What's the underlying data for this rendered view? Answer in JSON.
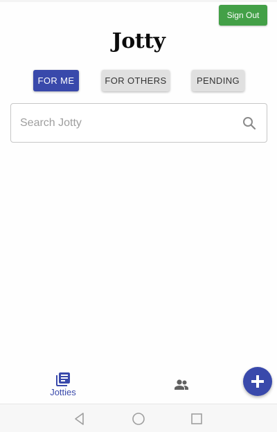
{
  "header": {
    "signout_label": "Sign Out",
    "logo_text": "Jotty"
  },
  "filters": [
    {
      "label": "FOR ME",
      "active": true
    },
    {
      "label": "FOR OTHERS",
      "active": false
    },
    {
      "label": "PENDING",
      "active": false
    }
  ],
  "search": {
    "placeholder": "Search Jotty",
    "value": "",
    "icon": "search-icon"
  },
  "bottom_nav": {
    "items": [
      {
        "label": "Jotties",
        "icon": "notes-icon",
        "active": true
      },
      {
        "label": "",
        "icon": "people-icon",
        "active": false
      }
    ],
    "fab_icon": "plus-icon"
  },
  "system_nav": {
    "icons": [
      "back-icon",
      "home-icon",
      "recents-icon"
    ]
  },
  "colors": {
    "primary": "#3949ab",
    "signout": "#43a047",
    "inactive_button": "#e0e0e0"
  }
}
